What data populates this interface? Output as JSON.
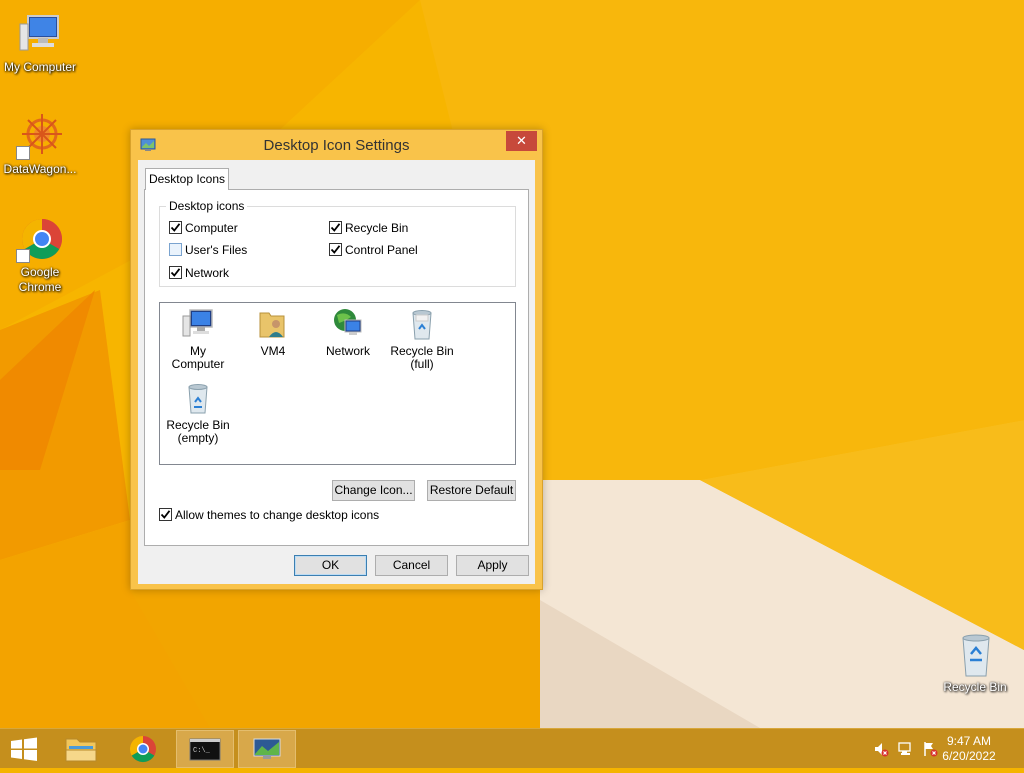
{
  "desktop": {
    "icons": [
      {
        "label": "My Computer"
      },
      {
        "label": "DataWagon..."
      },
      {
        "label": "Google Chrome"
      },
      {
        "label": "Recycle Bin"
      }
    ]
  },
  "dialog": {
    "title": "Desktop Icon Settings",
    "close_label": "✕",
    "tab_label": "Desktop Icons",
    "group_label": "Desktop icons",
    "checkboxes": [
      {
        "label": "Computer",
        "checked": true
      },
      {
        "label": "Recycle Bin",
        "checked": true
      },
      {
        "label": "User's Files",
        "checked": false
      },
      {
        "label": "Control Panel",
        "checked": true
      },
      {
        "label": "Network",
        "checked": true
      }
    ],
    "icon_items": [
      {
        "label": "My Computer",
        "icon": "computer-icon"
      },
      {
        "label": "VM4",
        "icon": "user-folder-icon"
      },
      {
        "label": "Network",
        "icon": "network-globe-icon"
      },
      {
        "label_line1": "Recycle Bin",
        "label_line2": "(full)",
        "icon": "recycle-bin-full-icon"
      },
      {
        "label_line1": "Recycle Bin",
        "label_line2": "(empty)",
        "icon": "recycle-bin-empty-icon"
      }
    ],
    "change_icon_label": "Change Icon...",
    "restore_default_label": "Restore Default",
    "allow_themes_label": "Allow themes to change desktop icons",
    "allow_themes_checked": true,
    "ok_label": "OK",
    "cancel_label": "Cancel",
    "apply_label": "Apply"
  },
  "taskbar": {
    "time": "9:47 AM",
    "date": "6/20/2022",
    "pinned": [
      "file-explorer-icon",
      "chrome-icon",
      "command-prompt-icon",
      "desktop-icon-settings-icon"
    ]
  },
  "colors": {
    "wallpaper": "#f5b400",
    "dialog_frame": "#f9c34a",
    "close_button": "#c7493b",
    "taskbar": "#c58f1d"
  }
}
